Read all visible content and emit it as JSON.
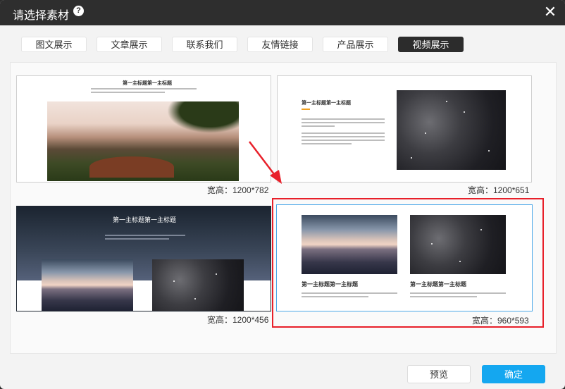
{
  "dialog": {
    "title": "请选择素材",
    "help_symbol": "?",
    "close_symbol": "✕"
  },
  "tabs": [
    {
      "label": "图文展示",
      "active": false
    },
    {
      "label": "文章展示",
      "active": false
    },
    {
      "label": "联系我们",
      "active": false
    },
    {
      "label": "友情链接",
      "active": false
    },
    {
      "label": "产品展示",
      "active": false
    },
    {
      "label": "视频展示",
      "active": true
    }
  ],
  "templates": [
    {
      "size": "宽高：1200*782",
      "heading": "第一主标题第一主标题",
      "selected": false
    },
    {
      "size": "宽高：1200*651",
      "heading": "第一主标题第一主标题",
      "selected": false
    },
    {
      "size": "宽高：1200*456",
      "heading": "第一主标题第一主标题",
      "selected": false
    },
    {
      "size": "宽高：960*593",
      "heading_left": "第一主标题第一主标题",
      "heading_right": "第一主标题第一主标题",
      "selected": true
    }
  ],
  "buttons": {
    "preview": "预览",
    "confirm": "确定"
  },
  "colors": {
    "accent": "#14a7f0",
    "highlight": "#e8202a",
    "titlebar": "#2e2e2e"
  }
}
